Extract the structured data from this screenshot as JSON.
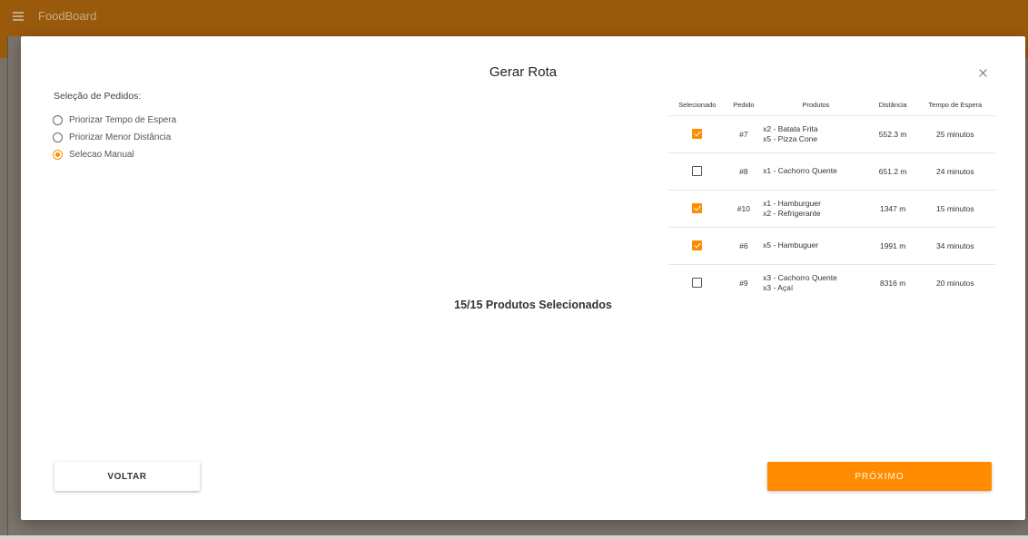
{
  "app": {
    "title": "FoodBoard"
  },
  "dialog": {
    "title": "Gerar Rota",
    "selection_label": "Seleção de Pedidos:",
    "options": [
      {
        "label": "Priorizar Tempo de Espera",
        "checked": false
      },
      {
        "label": "Priorizar Menor Distância",
        "checked": false
      },
      {
        "label": "Selecao Manual",
        "checked": true
      }
    ],
    "counter": "15/15 Produtos Selecionados",
    "back_label": "VOLTAR",
    "next_label": "PRÓXIMO"
  },
  "table": {
    "headers": [
      "Selecionado",
      "Pedido",
      "Produtos",
      "Distância",
      "Tempo de Espera"
    ],
    "rows": [
      {
        "selected": true,
        "order": "#7",
        "products": [
          "x2 - Batata Frita",
          "x5 - Pizza Cone"
        ],
        "distance": "552.3 m",
        "wait": "25 minutos"
      },
      {
        "selected": false,
        "order": "#8",
        "products": [
          "x1 - Cachorro Quente"
        ],
        "distance": "651.2 m",
        "wait": "24 minutos"
      },
      {
        "selected": true,
        "order": "#10",
        "products": [
          "x1 - Hamburguer",
          "x2 - Refrigerante"
        ],
        "distance": "1347 m",
        "wait": "15 minutos"
      },
      {
        "selected": true,
        "order": "#6",
        "products": [
          "x5 - Hambuguer"
        ],
        "distance": "1991 m",
        "wait": "34 minutos"
      },
      {
        "selected": false,
        "order": "#9",
        "products": [
          "x3 - Cachorro Quente",
          "x3 - Açaí"
        ],
        "distance": "8316 m",
        "wait": "20 minutos"
      }
    ]
  },
  "colors": {
    "accent": "#ff8c00",
    "appbar": "#9a5a0b"
  }
}
